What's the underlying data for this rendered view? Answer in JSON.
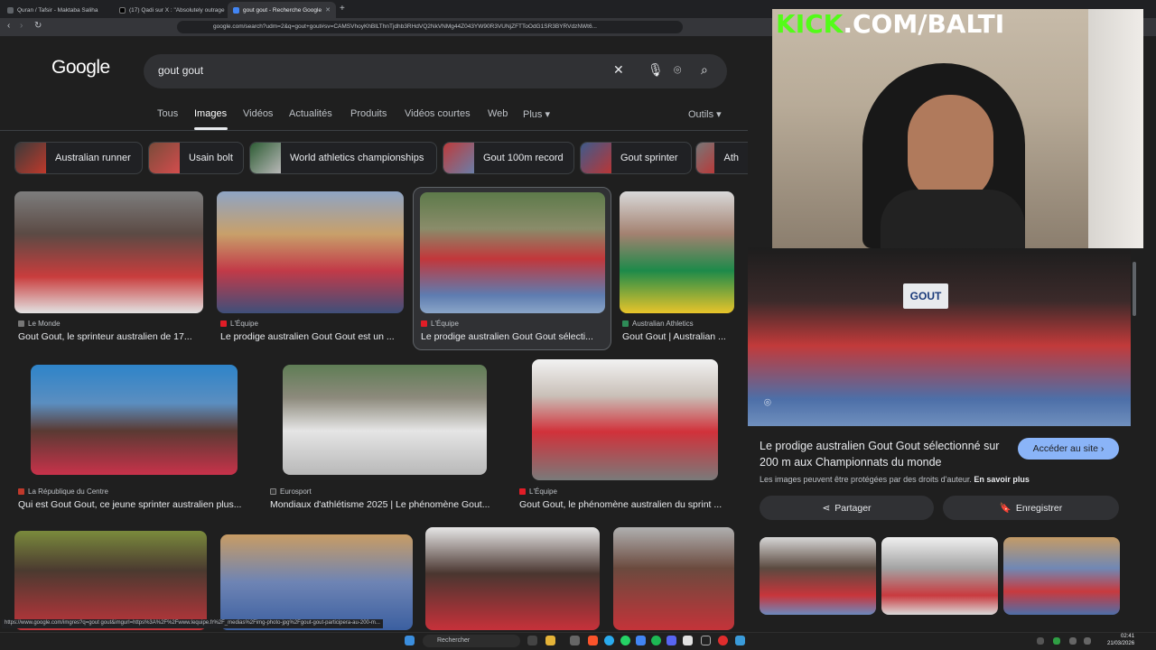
{
  "browser": {
    "tabs": [
      {
        "label": "Quran / Tafsir - Maktaba Saliha",
        "active": false
      },
      {
        "label": "(17) Qadi sur X : \"Absolutely outrage",
        "active": false
      },
      {
        "label": "gout gout - Recherche Google",
        "active": true
      }
    ],
    "url": "google.com/search?udm=2&q=gout+gout#sv=CAMSVhoyKhBlLThnTjdhb3RHdVQ2NkVNMg44Z043YW90R3VUNjZFTToOdG1SR3BYRVdzNWt6..."
  },
  "google": {
    "logo": "Google",
    "query": "gout gout",
    "tabs": [
      "Tous",
      "Images",
      "Vidéos",
      "Actualités",
      "Produits",
      "Vidéos courtes",
      "Web",
      "Plus ▾"
    ],
    "tools": "Outils ▾",
    "chips": [
      "Australian runner",
      "Usain bolt",
      "World athletics championships",
      "Gout 100m record",
      "Gout sprinter",
      "Ath"
    ]
  },
  "results": [
    {
      "source": "Le Monde",
      "title": "Gout Gout, le sprinteur australien de 17..."
    },
    {
      "source": "L'Équipe",
      "title": "Le prodige australien Gout Gout est un ..."
    },
    {
      "source": "L'Équipe",
      "title": "Le prodige australien Gout Gout sélecti..."
    },
    {
      "source": "Australian Athletics",
      "title": "Gout Gout | Australian ..."
    },
    {
      "source": "La République du Centre",
      "title": "Qui est Gout Gout, ce jeune sprinter australien plus..."
    },
    {
      "source": "Eurosport",
      "title": "Mondiaux d'athlétisme 2025 | Le phénomène Gout..."
    },
    {
      "source": "L'Équipe",
      "title": "Gout Gout, le phénomène australien du sprint ..."
    }
  ],
  "panel": {
    "title": "Le prodige australien Gout Gout sélectionné sur 200 m aux Championnats du monde",
    "visit": "Accéder au site ›",
    "copyright": "Les images peuvent être protégées par des droits d'auteur.",
    "learn_more": "En savoir plus",
    "share": "Partager",
    "save": "Enregistrer"
  },
  "overlay": {
    "kick_green": "KICK",
    "kick_white": ".COM/BALTI"
  },
  "statusbar": "https://www.google.com/imgres?q=gout gout&imgurl=https%3A%2F%2Fwww.lequipe.fr%2F_medias%2Fimg-photo-jpg%2Fgout-gout-participera-au-200-m...",
  "taskbar": {
    "search": "Rechercher",
    "time": "02:41",
    "date": "21/03/2026"
  },
  "colors": {
    "accent": "#8ab4f8",
    "kick": "#53fc18",
    "background": "#1f1f1f"
  }
}
